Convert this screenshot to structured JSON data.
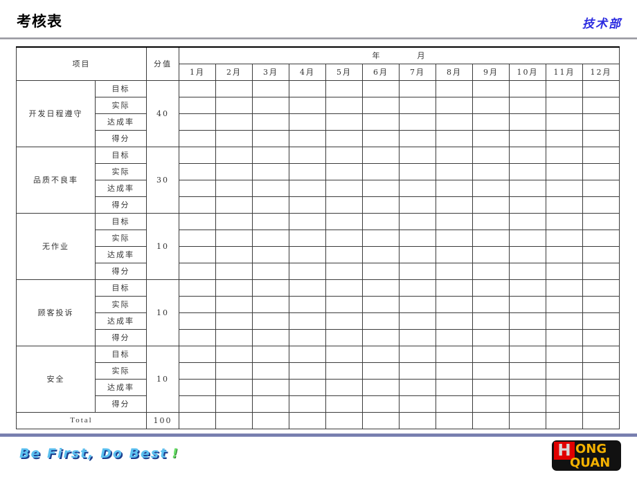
{
  "header": {
    "title": "考核表",
    "department": "技术部"
  },
  "footer": {
    "slogan": "Be First, Do Best",
    "slogan_mark": "!",
    "logo": {
      "letter": "H",
      "line1": "ONG",
      "line2": "QUAN"
    }
  },
  "table": {
    "headers": {
      "item": "项目",
      "score": "分值",
      "period_year": "年",
      "period_month": "月"
    },
    "months": [
      "1月",
      "2月",
      "3月",
      "4月",
      "5月",
      "6月",
      "7月",
      "8月",
      "9月",
      "10月",
      "11月",
      "12月"
    ],
    "sub_rows": [
      "目标",
      "实际",
      "达成率",
      "得分"
    ],
    "sections": [
      {
        "name": "开发日程遵守",
        "score": "40"
      },
      {
        "name": "品质不良率",
        "score": "30"
      },
      {
        "name": "无作业",
        "score": "10"
      },
      {
        "name": "顾客投诉",
        "score": "10"
      },
      {
        "name": "安全",
        "score": "10"
      }
    ],
    "total": {
      "label": "Total",
      "score": "100"
    }
  },
  "colors": {
    "title": "#000000",
    "department": "#2b2be0",
    "slogan": "#5bc0f0",
    "slogan_shadow": "#1d3f8f",
    "slogan_mark": "#66dd66",
    "footer_rule": "#6b72a6",
    "header_rule": "#8e8e96",
    "logo_red": "#e00000",
    "logo_gold": "#f5b200",
    "logo_black": "#111111",
    "table_border": "#3a3a3a"
  }
}
